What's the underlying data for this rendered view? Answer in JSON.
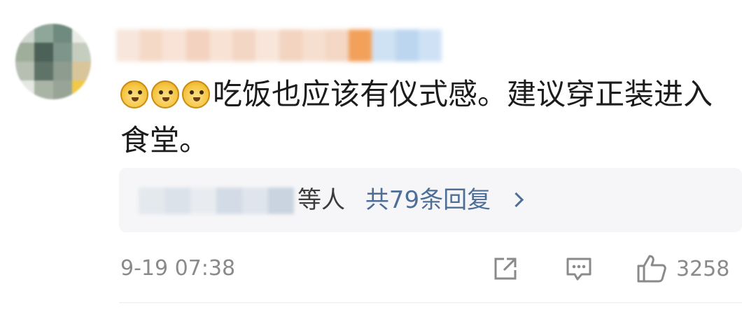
{
  "comment": {
    "emoji": [
      "doge",
      "doge",
      "doge"
    ],
    "text": "吃饭也应该有仪式感。建议穿正装进入食堂。",
    "timestamp": "9-19 07:38"
  },
  "replies": {
    "suffix": "等人",
    "link": "共79条回复"
  },
  "actions": {
    "share_icon": "share-icon",
    "reply_icon": "comment-icon",
    "like_icon": "thumbs-up-icon",
    "like_count": "3258"
  },
  "colors": {
    "link": "#4d6e96",
    "meta": "#8a8a8a",
    "reply_bg": "#f6f6f8"
  }
}
